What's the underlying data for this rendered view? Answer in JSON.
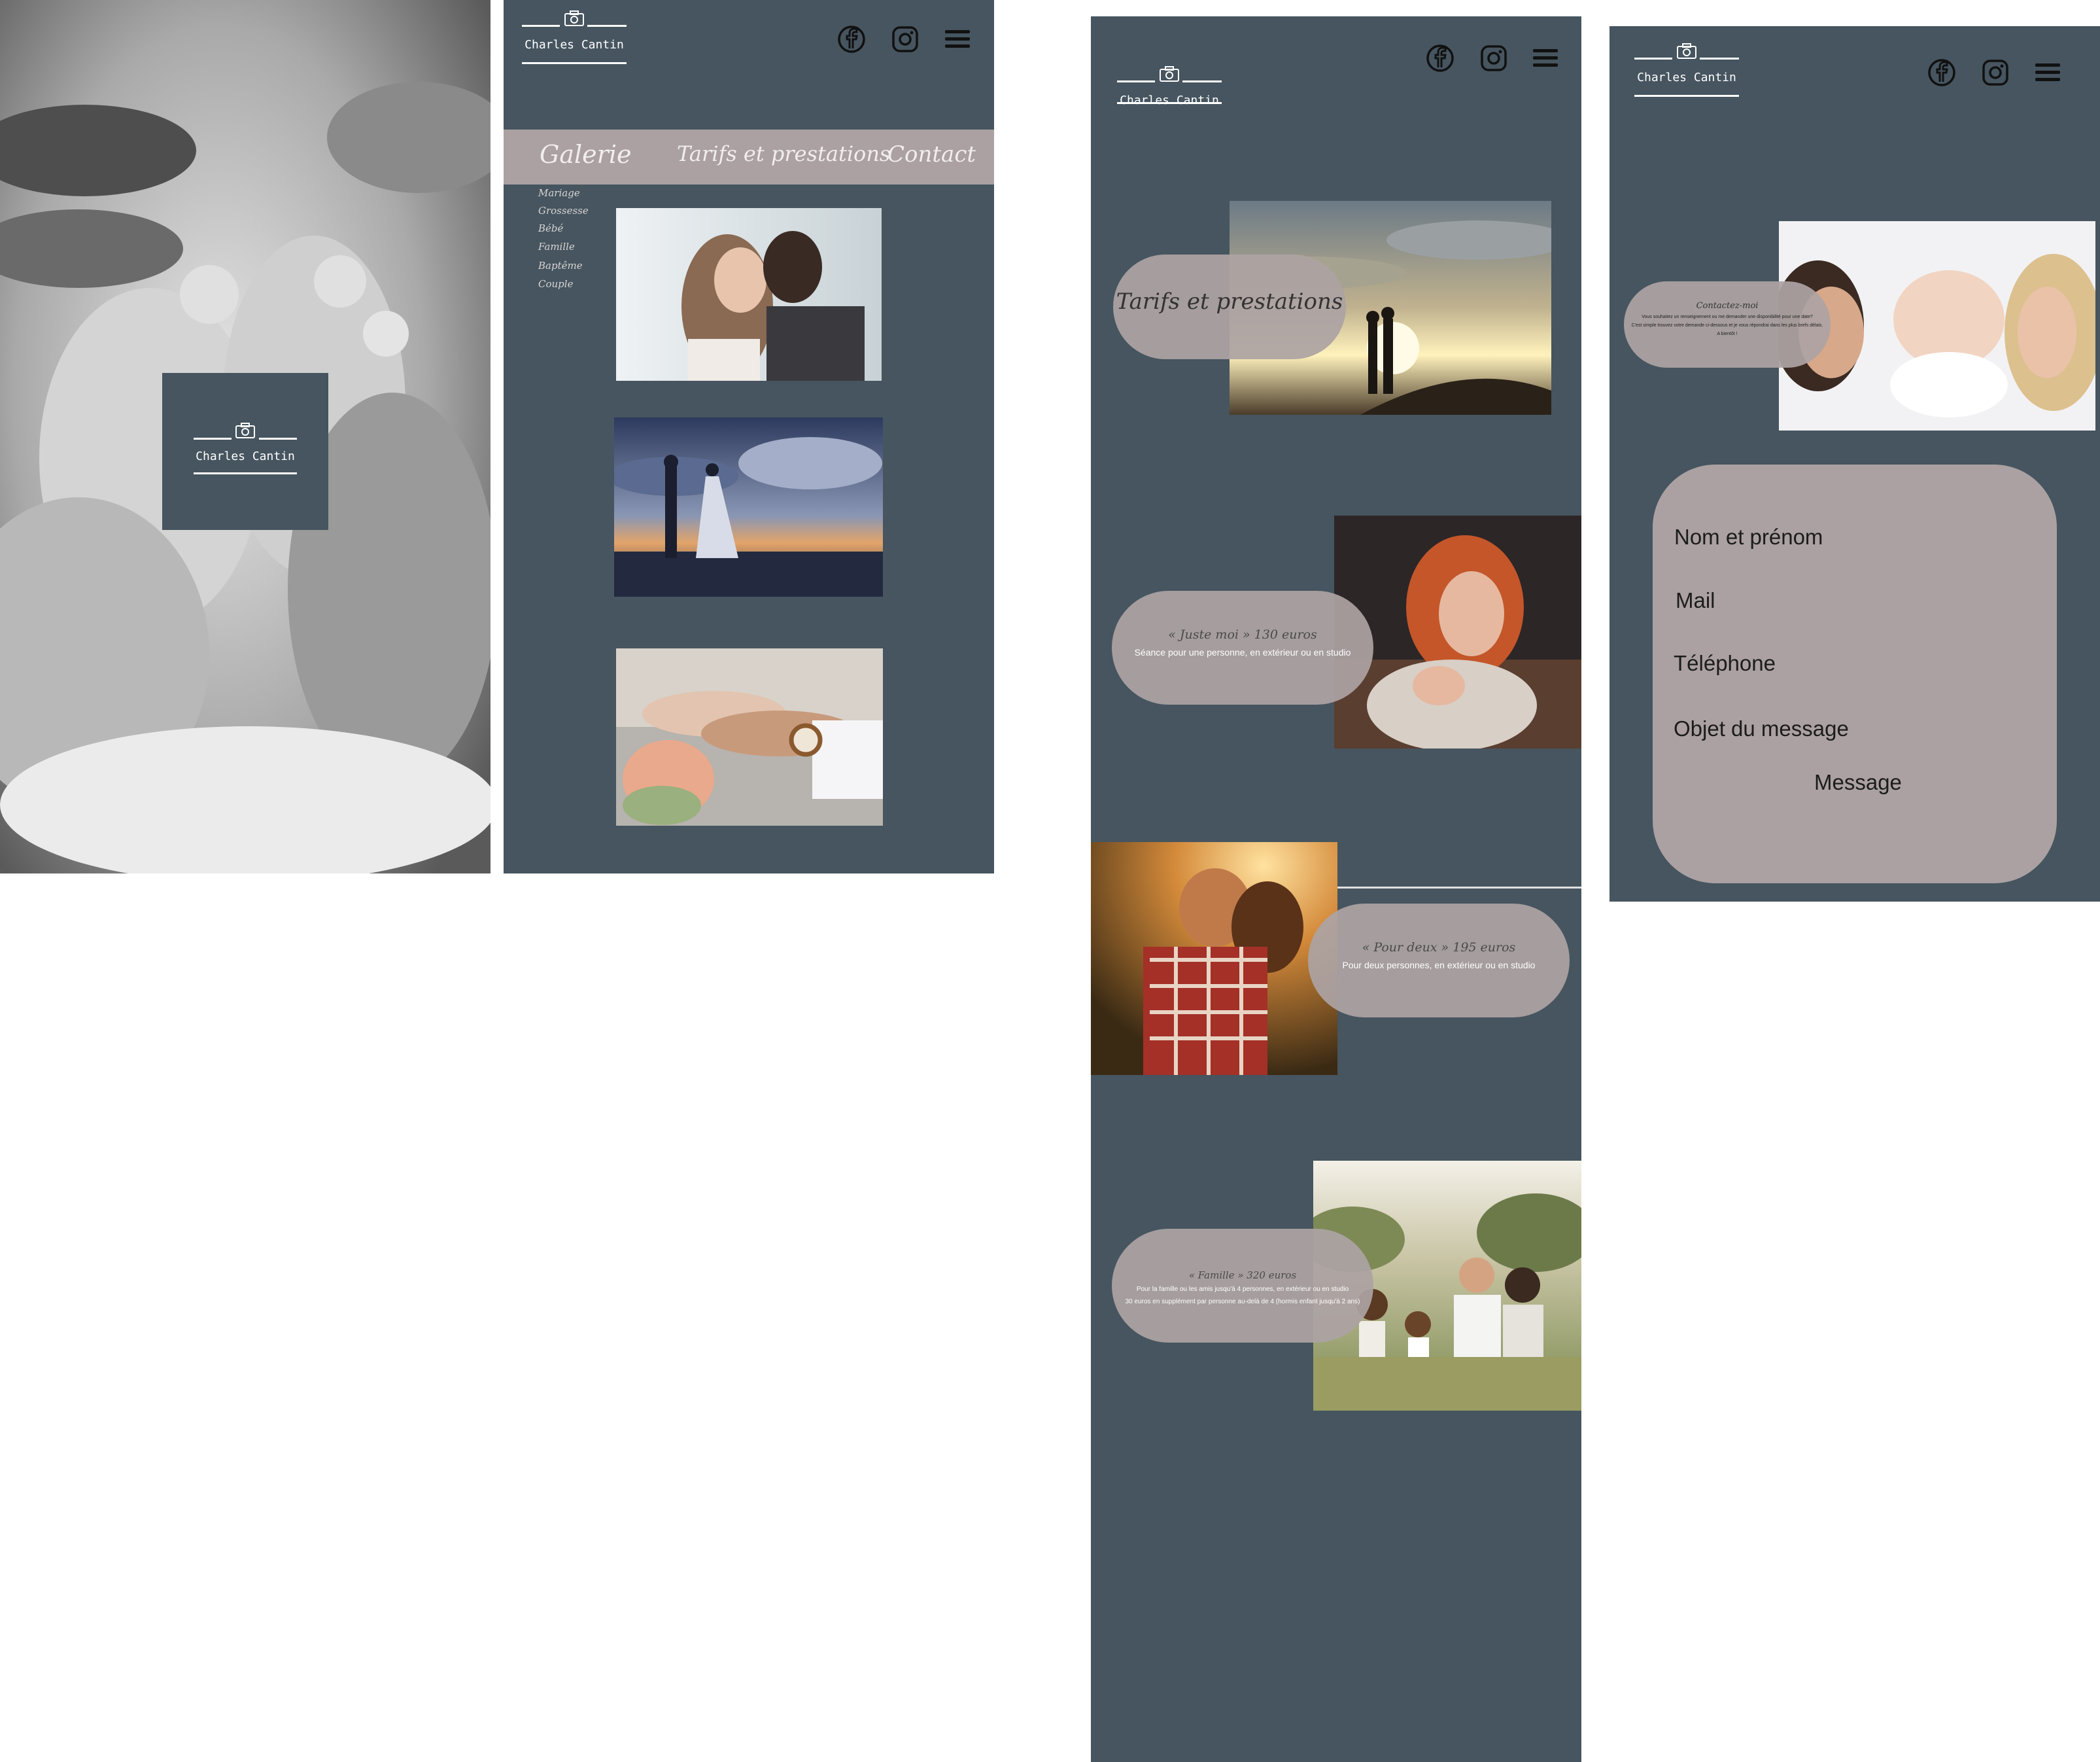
{
  "colors": {
    "panel": "#46555f",
    "accent": "#aba1a2",
    "text_light": "#ffffff"
  },
  "brand": {
    "name": "Charles Cantin"
  },
  "screen1": {
    "logo_icon": "camera-icon"
  },
  "screen2": {
    "icons": [
      "facebook-icon",
      "instagram-icon",
      "menu-icon"
    ],
    "nav": {
      "galerie": "Galerie",
      "tarifs": "Tarifs et prestations",
      "contact": "Contact"
    },
    "submenu": [
      "Mariage",
      "Grossesse",
      "Bébé",
      "Famille",
      "Baptême",
      "Couple"
    ]
  },
  "screen3": {
    "icons": [
      "facebook-icon",
      "instagram-icon",
      "menu-icon"
    ],
    "section_title": "Tarifs et prestations",
    "offers": [
      {
        "title": "« Juste moi » 130 euros",
        "desc": "Séance pour une personne, en extérieur ou en studio"
      },
      {
        "title": "« Pour deux » 195 euros",
        "desc": "Pour deux personnes, en extérieur ou en studio"
      },
      {
        "title": "« Famille » 320 euros",
        "desc": "Pour la famille ou les amis jusqu'à 4 personnes, en extérieur ou en studio",
        "desc2": "30 euros en supplément par personne au-delà de 4 (hormis enfant jusqu'à 2 ans)"
      }
    ]
  },
  "screen4": {
    "icons": [
      "facebook-icon",
      "instagram-icon",
      "menu-icon"
    ],
    "contact_title": "Contactez-moi",
    "contact_text1": "Vous souhaitez un renseignement ou me demander une disponibilité pour une date?",
    "contact_text2": "C'est simple trouvez votre demande ci-dessous et je vous répondrai dans les plus brefs délais.",
    "contact_text3": "A bientôt !",
    "form": {
      "name": "Nom et prénom",
      "mail": "Mail",
      "phone": "Téléphone",
      "subject": "Objet du message",
      "message": "Message"
    }
  }
}
